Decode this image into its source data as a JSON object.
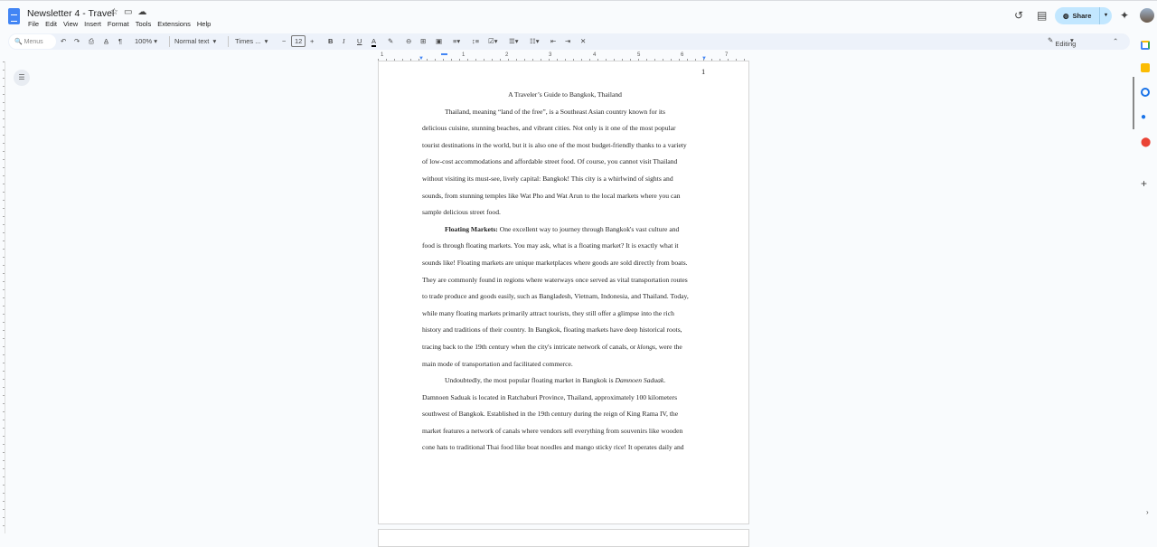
{
  "title": "Newsletter 4 - Travel",
  "menu": [
    "File",
    "Edit",
    "View",
    "Insert",
    "Format",
    "Tools",
    "Extensions",
    "Help"
  ],
  "toolbar": {
    "search_placeholder": "Menus",
    "zoom": "100%",
    "style": "Normal text",
    "font": "Times ...",
    "font_size": "12",
    "mode": "Editing"
  },
  "share_label": "Share",
  "ruler_numbers": [
    "1",
    "1",
    "2",
    "3",
    "4",
    "5",
    "6",
    "7"
  ],
  "page_number": "1",
  "document": {
    "title": "A Traveler’s Guide to Bangkok, Thailand",
    "p1": [
      "Thailand, meaning “land of the free”, is a Southeast Asian country known for its",
      "delicious cuisine, stunning beaches, and vibrant cities. Not only is it one of the most popular",
      "tourist destinations in the world, but it is also one of the most budget-friendly thanks to a variety",
      "of low-cost accommodations and affordable street food. Of course, you cannot visit Thailand",
      "without visiting its must-see, lively capital: Bangkok! This city is a whirlwind of sights and",
      "sounds, from stunning temples like Wat Pho and Wat Arun to the local markets where you can",
      "sample delicious street food."
    ],
    "p2_bold": "Floating Markets:",
    "p2_first": " One excellent way to journey through Bangkok's vast culture and",
    "p2": [
      "food is through floating markets. You may ask, what is a floating market? It is exactly what it",
      "sounds like! Floating markets are unique marketplaces where goods are sold directly from boats.",
      "They are commonly found in regions where waterways once served as vital transportation routes",
      "to trade produce and goods easily, such as Bangladesh, Vietnam, Indonesia, and Thailand. Today,",
      "while many floating markets primarily attract tourists, they still offer a glimpse into the rich",
      "history and traditions of their country. In Bangkok, floating markets have deep historical roots,"
    ],
    "p2_klongs_pre": "tracing back to the 19th century when the city's intricate network of canals, or ",
    "p2_klongs": "klongs",
    "p2_klongs_post": ", were the",
    "p2_last": "main mode of transportation and facilitated commerce.",
    "p3_first": "Undoubtedly, the most popular floating market in Bangkok is ",
    "p3_italic": "Damnoen Saduak",
    "p3_period": ".",
    "p3": [
      "Damnoen Saduak is located in Ratchaburi Province, Thailand, approximately 100 kilometers",
      "southwest of Bangkok. Established in the 19th century during the reign of King Rama IV, the",
      "market features a network of canals where vendors sell everything from souvenirs like wooden",
      "cone hats to traditional Thai food like boat noodles and mango sticky rice! It operates daily and"
    ]
  }
}
